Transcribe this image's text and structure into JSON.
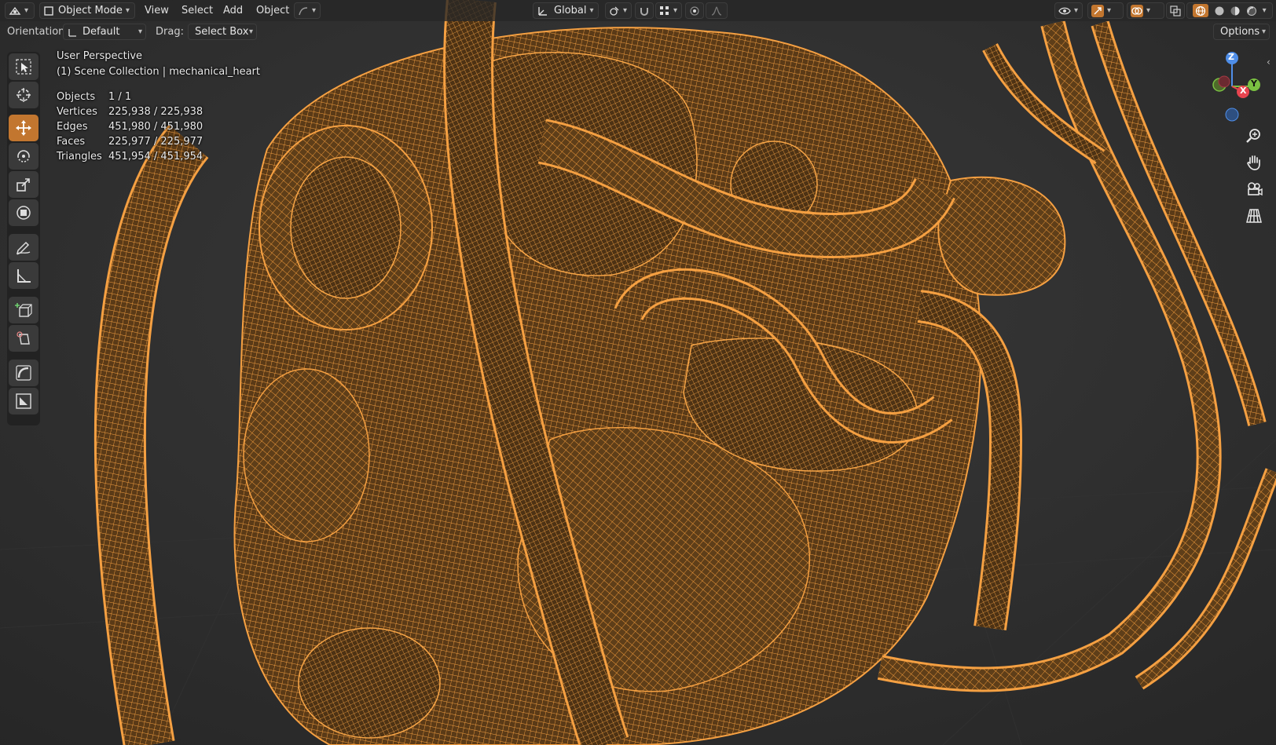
{
  "header": {
    "mode_label": "Object Mode",
    "menu": {
      "view": "View",
      "select": "Select",
      "add": "Add",
      "object": "Object"
    },
    "transform_orientation": "Global",
    "options_label": "Options"
  },
  "tool_settings": {
    "orientation_label": "Orientation:",
    "orientation_value": "Default",
    "drag_label": "Drag:",
    "drag_value": "Select Box"
  },
  "toolbar": {
    "tools": [
      {
        "name": "select-box-tool",
        "icon": "cursor-arrow-icon",
        "active": false
      },
      {
        "name": "cursor-tool",
        "icon": "crosshair-cursor-icon",
        "active": false
      },
      {
        "name": "move-tool",
        "icon": "move-arrows-icon",
        "active": true
      },
      {
        "name": "rotate-tool",
        "icon": "rotate-icon",
        "active": false
      },
      {
        "name": "scale-tool",
        "icon": "scale-icon",
        "active": false
      },
      {
        "name": "transform-tool",
        "icon": "transform-icon",
        "active": false
      },
      {
        "name": "annotate-tool",
        "icon": "pencil-icon",
        "active": false
      },
      {
        "name": "measure-tool",
        "icon": "ruler-icon",
        "active": false
      },
      {
        "name": "add-cube-tool",
        "icon": "add-cube-icon",
        "active": false
      },
      {
        "name": "shear-tool",
        "icon": "shear-icon",
        "active": false
      },
      {
        "name": "curve-tool",
        "icon": "curve-icon",
        "active": false
      },
      {
        "name": "bounds-tool",
        "icon": "bounds-icon",
        "active": false
      }
    ]
  },
  "overlay": {
    "view_name": "User Perspective",
    "collection": "(1) Scene Collection | mechanical_heart",
    "stats": [
      {
        "label": "Objects",
        "value": "1 / 1"
      },
      {
        "label": "Vertices",
        "value": "225,938 / 225,938"
      },
      {
        "label": "Edges",
        "value": "451,980 / 451,980"
      },
      {
        "label": "Faces",
        "value": "225,977 / 225,977"
      },
      {
        "label": "Triangles",
        "value": "451,954 / 451,954"
      }
    ]
  },
  "gizmo": {
    "z": "Z",
    "y": "Y",
    "x": "X"
  },
  "colors": {
    "wire": "#f5a042",
    "accent": "#c2762f",
    "background": "#2a2a2a"
  }
}
